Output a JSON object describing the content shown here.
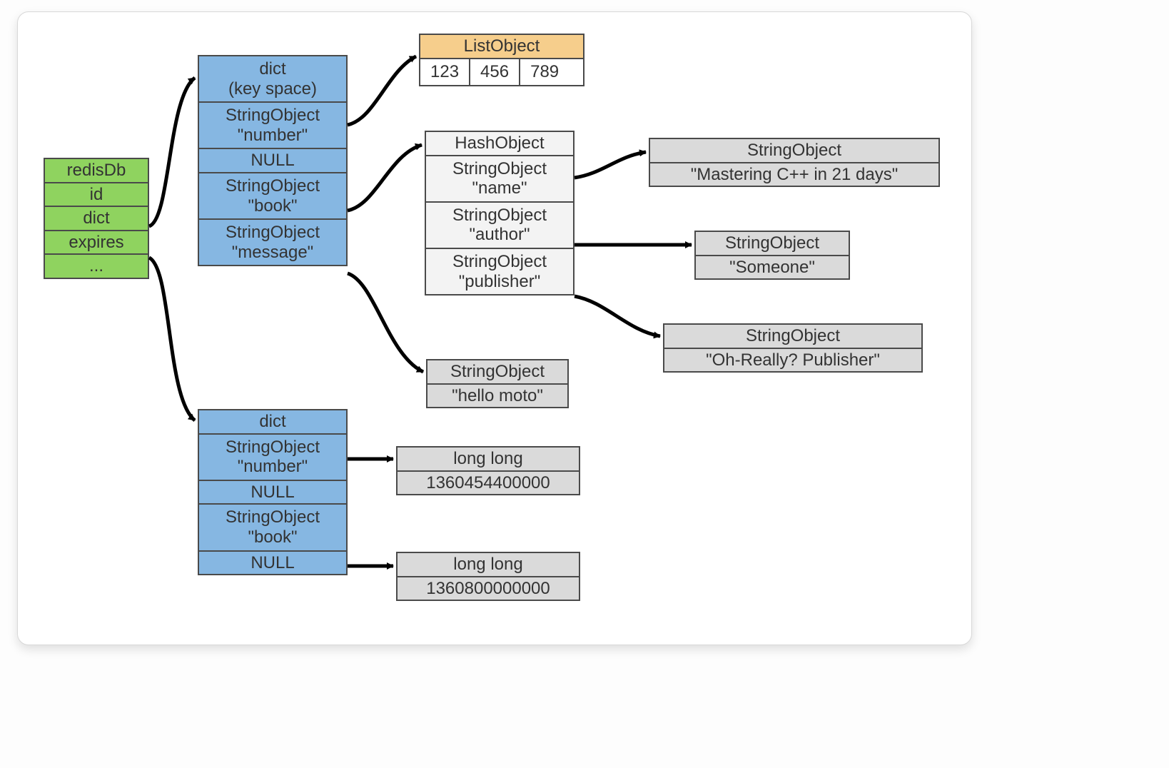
{
  "redisDb": {
    "title": "redisDb",
    "fields": [
      "id",
      "dict",
      "expires",
      "..."
    ]
  },
  "keyspace": {
    "title_line1": "dict",
    "title_line2": "(key space)",
    "entries": [
      {
        "type": "StringObject",
        "key": "\"number\""
      },
      {
        "null": "NULL"
      },
      {
        "type": "StringObject",
        "key": "\"book\""
      },
      {
        "type": "StringObject",
        "key": "\"message\""
      }
    ]
  },
  "listObject": {
    "title": "ListObject",
    "items": [
      "123",
      "456",
      "789"
    ]
  },
  "hashObject": {
    "title": "HashObject",
    "fields": [
      {
        "type": "StringObject",
        "key": "\"name\""
      },
      {
        "type": "StringObject",
        "key": "\"author\""
      },
      {
        "type": "StringObject",
        "key": "\"publisher\""
      }
    ]
  },
  "hashValues": {
    "name": {
      "type": "StringObject",
      "value": "\"Mastering C++ in 21 days\""
    },
    "author": {
      "type": "StringObject",
      "value": "\"Someone\""
    },
    "publisher": {
      "type": "StringObject",
      "value": "\"Oh-Really? Publisher\""
    }
  },
  "messageString": {
    "type": "StringObject",
    "value": "\"hello moto\""
  },
  "expiresDict": {
    "title": "dict",
    "entries": [
      {
        "type": "StringObject",
        "key": "\"number\""
      },
      {
        "null": "NULL"
      },
      {
        "type": "StringObject",
        "key": "\"book\""
      },
      {
        "null2": "NULL"
      }
    ]
  },
  "expiresValues": {
    "number": {
      "type": "long long",
      "value": "1360454400000"
    },
    "book": {
      "type": "long long",
      "value": "1360800000000"
    }
  }
}
